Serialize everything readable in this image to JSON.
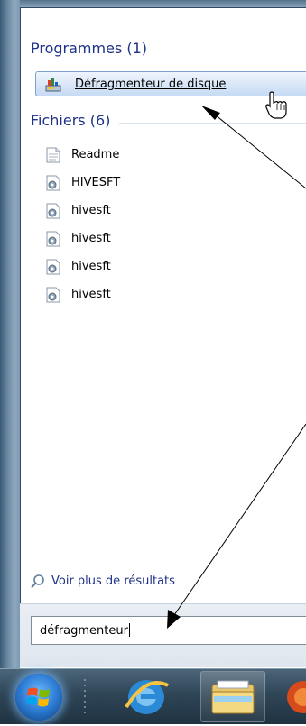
{
  "groups": {
    "programs": {
      "header": "Programmes (1)",
      "items": [
        {
          "label": "Défragmenteur de disque",
          "icon": "defrag-icon"
        }
      ]
    },
    "files": {
      "header": "Fichiers (6)",
      "items": [
        {
          "label": "Readme",
          "icon": "text-file-icon"
        },
        {
          "label": "HIVESFT",
          "icon": "system-file-icon"
        },
        {
          "label": "hivesft",
          "icon": "system-file-icon"
        },
        {
          "label": "hivesft",
          "icon": "system-file-icon"
        },
        {
          "label": "hivesft",
          "icon": "system-file-icon"
        },
        {
          "label": "hivesft",
          "icon": "system-file-icon"
        }
      ]
    }
  },
  "more_results": {
    "label": "Voir plus de résultats",
    "icon": "search-icon"
  },
  "search": {
    "value": "défragmenteur"
  },
  "taskbar": {
    "items": [
      {
        "name": "start-button",
        "icon": "windows-orb-icon"
      },
      {
        "name": "internet-explorer-button",
        "icon": "ie-icon"
      },
      {
        "name": "file-explorer-button",
        "icon": "folder-icon"
      },
      {
        "name": "media-player-button",
        "icon": "media-player-icon"
      }
    ]
  },
  "colors": {
    "group_header": "#1e3287",
    "selection_border": "#7da2ce",
    "taskbar": "#2f4657"
  }
}
